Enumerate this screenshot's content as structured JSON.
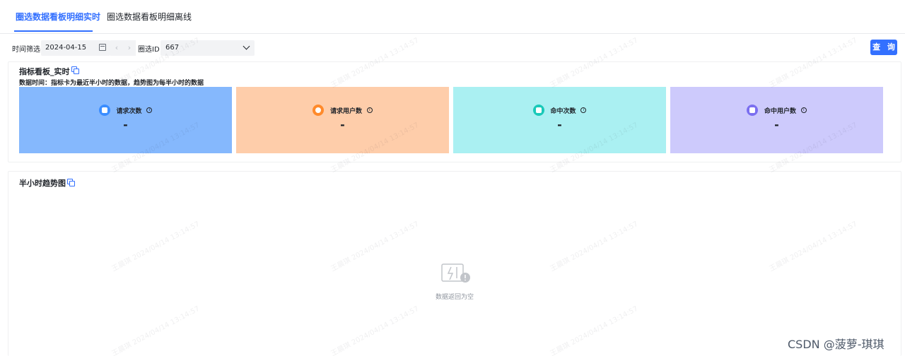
{
  "tabs": [
    {
      "label": "圈选数据看板明细实时",
      "active": true
    },
    {
      "label": "圈选数据看板明细离线",
      "active": false
    }
  ],
  "filters": {
    "time_label": "时间筛选",
    "date_value": "2024-04-15",
    "id_label": "圈选ID",
    "id_value": "667",
    "query_button": "查 询"
  },
  "realtime_panel": {
    "title": "指标看板_实时",
    "description": "数据时间：指标卡为最近半小时的数据，趋势图为每半小时的数据",
    "cards": [
      {
        "label": "请求次数",
        "value": "-",
        "bg": "#85b8fd",
        "icon_bg": "#3a8dff",
        "icon": "request-count-icon"
      },
      {
        "label": "请求用户数",
        "value": "-",
        "bg": "#fecdaa",
        "icon_bg": "#ff8a2b",
        "icon": "eye-icon"
      },
      {
        "label": "命中次数",
        "value": "-",
        "bg": "#aaf0f2",
        "icon_bg": "#19c9b9",
        "icon": "hit-count-icon"
      },
      {
        "label": "命中用户数",
        "value": "-",
        "bg": "#cdcafc",
        "icon_bg": "#7b6ff0",
        "icon": "hit-user-icon"
      }
    ]
  },
  "trend_panel": {
    "title": "半小时趋势图",
    "empty_text": "数据返回为空"
  },
  "watermark_text": "王晨琪 2024/04/14 13:14:57",
  "footer_watermark": "CSDN @菠萝-琪琪"
}
